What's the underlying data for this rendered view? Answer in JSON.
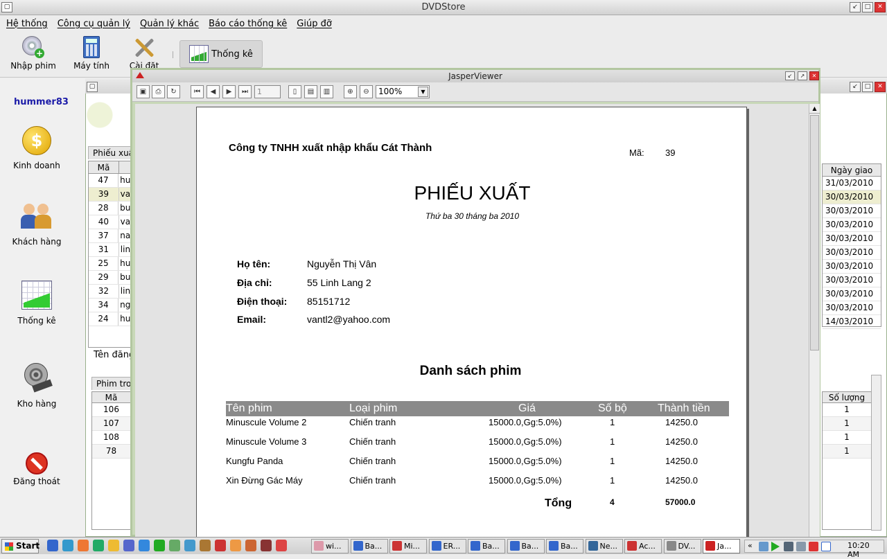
{
  "app": {
    "title": "DVDStore"
  },
  "menu": {
    "items": [
      "Hệ thống",
      "Công cụ quản lý",
      "Quản lý khác",
      "Báo cáo thống kê",
      "Giúp đỡ"
    ]
  },
  "toolbar": {
    "import_label": "Nhập phim",
    "calc_label": "Máy tính",
    "settings_label": "Cài đặt",
    "stats_label": "Thống kê"
  },
  "sidebar": {
    "user": "hummer83",
    "items": [
      "Kinh doanh",
      "Khách hàng",
      "Thống kê",
      "Kho hàng",
      "Đăng thoát"
    ]
  },
  "background": {
    "tab1": "Phiếu xuất",
    "table1": {
      "col_ma": "Mã",
      "col_ngay": "Ngày giao",
      "rows": [
        {
          "ma": "47",
          "ten": "hu",
          "ngay": "31/03/2010"
        },
        {
          "ma": "39",
          "ten": "va",
          "ngay": "30/03/2010"
        },
        {
          "ma": "28",
          "ten": "bu",
          "ngay": "30/03/2010"
        },
        {
          "ma": "40",
          "ten": "va",
          "ngay": "30/03/2010"
        },
        {
          "ma": "37",
          "ten": "na",
          "ngay": "30/03/2010"
        },
        {
          "ma": "31",
          "ten": "lin",
          "ngay": "30/03/2010"
        },
        {
          "ma": "25",
          "ten": "hu",
          "ngay": "30/03/2010"
        },
        {
          "ma": "29",
          "ten": "bu",
          "ngay": "30/03/2010"
        },
        {
          "ma": "32",
          "ten": "lin",
          "ngay": "30/03/2010"
        },
        {
          "ma": "34",
          "ten": "ng",
          "ngay": "30/03/2010"
        },
        {
          "ma": "24",
          "ten": "hu",
          "ngay": "14/03/2010"
        }
      ]
    },
    "ten_dang_label": "Tên đăng",
    "tab2": "Phim tro",
    "table2": {
      "col_ma": "Mã",
      "col_sl": "Số lượng",
      "rows": [
        {
          "ma": "106",
          "sl": "1"
        },
        {
          "ma": "107",
          "sl": "1"
        },
        {
          "ma": "108",
          "sl": "1"
        },
        {
          "ma": "78",
          "sl": "1"
        }
      ]
    }
  },
  "viewer": {
    "title": "JasperViewer",
    "page_num": "1",
    "zoom": "100%"
  },
  "report": {
    "company": "Công ty TNHH xuất nhập khẩu Cát Thành",
    "ma_label": "Mã:",
    "ma_value": "39",
    "title": "PHIẾU XUẤT",
    "date": "Thứ ba 30 tháng ba 2010",
    "fields": [
      {
        "label": "Họ tên:",
        "value": "Nguyễn Thị Vân"
      },
      {
        "label": "Địa chỉ:",
        "value": "55 Linh Lang 2"
      },
      {
        "label": "Điện thoại:",
        "value": "85151712"
      },
      {
        "label": "Email:",
        "value": "vantl2@yahoo.com"
      }
    ],
    "list_title": "Danh sách phim",
    "headers": {
      "ten": "Tên phim",
      "loai": "Loại phim",
      "gia": "Giá",
      "sobo": "Số bộ",
      "thanhtien": "Thành tiền"
    },
    "rows": [
      {
        "ten": "Minuscule Volume 2",
        "loai": "Chiến tranh",
        "gia": "15000.0,Gg:5.0%)",
        "sobo": "1",
        "thanhtien": "14250.0"
      },
      {
        "ten": "Minuscule Volume 3",
        "loai": "Chiến tranh",
        "gia": "15000.0,Gg:5.0%)",
        "sobo": "1",
        "thanhtien": "14250.0"
      },
      {
        "ten": "Kungfu Panda",
        "loai": "Chiến tranh",
        "gia": "15000.0,Gg:5.0%)",
        "sobo": "1",
        "thanhtien": "14250.0"
      },
      {
        "ten": "Xin Đừng Gác Máy",
        "loai": "Chiến tranh",
        "gia": "15000.0,Gg:5.0%)",
        "sobo": "1",
        "thanhtien": "14250.0"
      }
    ],
    "total_label": "Tổng",
    "total_sobo": "4",
    "total_tien": "57000.0"
  },
  "taskbar": {
    "start": "Start",
    "tasks": [
      "wi...",
      "Ba...",
      "Mi...",
      "ER...",
      "Ba...",
      "Ba...",
      "Ba...",
      "Ne...",
      "Ac...",
      "DV...",
      "Ja..."
    ],
    "clock": "10:20 AM"
  }
}
